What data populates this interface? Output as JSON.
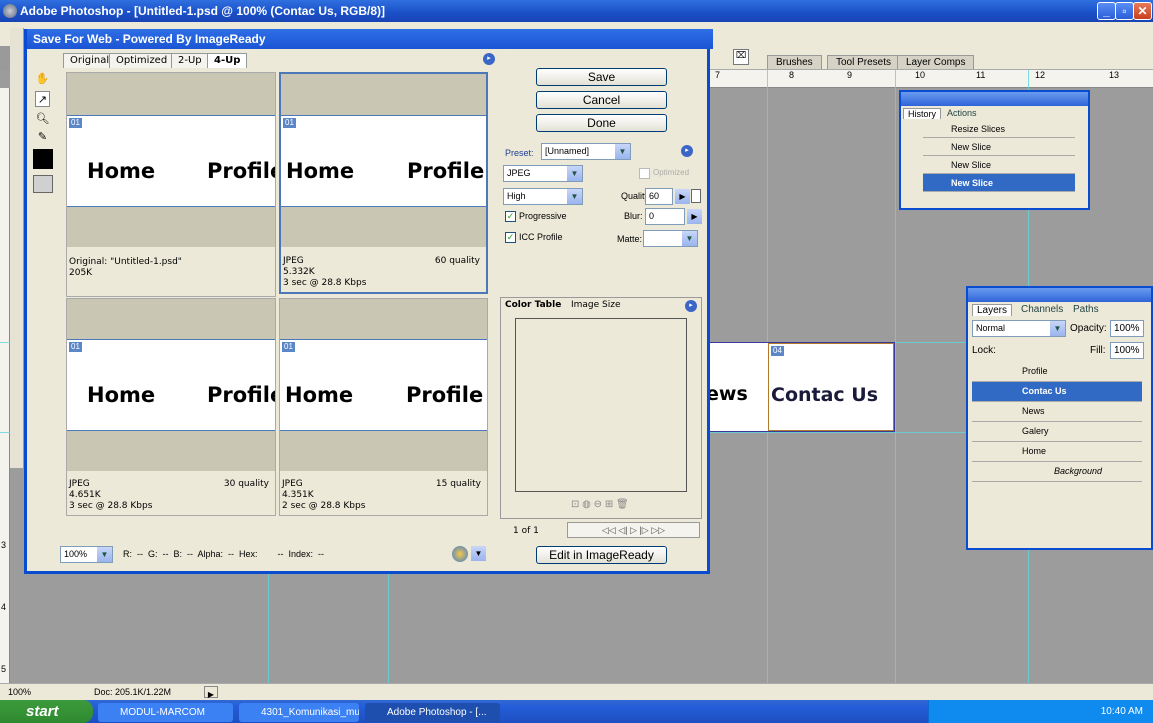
{
  "app": {
    "title": "Adobe Photoshop - [Untitled-1.psd @ 100% (Contac Us, RGB/8)]"
  },
  "palette_well": {
    "tabs": [
      "Brushes",
      "Tool Presets",
      "Layer Comps"
    ]
  },
  "rulers": {
    "top": [
      "7",
      "8",
      "9",
      "10",
      "11",
      "12",
      "13"
    ],
    "left": [
      "3",
      "4",
      "5"
    ]
  },
  "canvas": {
    "visible_text_1": "ews",
    "visible_text_2": "Contac Us",
    "slice_tag": "04"
  },
  "dialog": {
    "title": "Save For Web - Powered By ImageReady",
    "tabs": [
      "Original",
      "Optimized",
      "2-Up",
      "4-Up"
    ],
    "active_tab": "4-Up",
    "panes": [
      {
        "slice": "01",
        "home": "Home",
        "profile": "Profile",
        "info_left": [
          "Original: \"Untitled-1.psd\"",
          "205K"
        ],
        "info_right": ""
      },
      {
        "slice": "01",
        "home": "Home",
        "profile": "Profile",
        "info_left": [
          "JPEG",
          "5.332K",
          "3 sec @ 28.8 Kbps"
        ],
        "info_right": "60 quality"
      },
      {
        "slice": "01",
        "home": "Home",
        "profile": "Profile",
        "info_left": [
          "JPEG",
          "4.651K",
          "3 sec @ 28.8 Kbps"
        ],
        "info_right": "30 quality"
      },
      {
        "slice": "01",
        "home": "Home",
        "profile": "Profile",
        "info_left": [
          "JPEG",
          "4.351K",
          "2 sec @ 28.8 Kbps"
        ],
        "info_right": "15 quality"
      }
    ],
    "buttons": {
      "save": "Save",
      "cancel": "Cancel",
      "done": "Done",
      "edit": "Edit in ImageReady"
    },
    "settings": {
      "preset_label": "Preset:",
      "preset_value": "[Unnamed]",
      "format": "JPEG",
      "optimized_label": "Optimized",
      "quality_level": "High",
      "quality_label": "Quality:",
      "quality_value": "60",
      "progressive_label": "Progressive",
      "blur_label": "Blur:",
      "blur_value": "0",
      "icc_label": "ICC Profile",
      "matte_label": "Matte:"
    },
    "color_tabs": [
      "Color Table",
      "Image Size"
    ],
    "pager": "1 of 1",
    "zoom": "100%",
    "status_fields": "R:  --  G:  --  B:  --  Alpha:  --  Hex:        --  Index:  --"
  },
  "history": {
    "tabs": [
      "History",
      "Actions"
    ],
    "items": [
      "Resize Slices",
      "New Slice",
      "New Slice",
      "New Slice"
    ],
    "selected_index": 3
  },
  "layers": {
    "tabs": [
      "Layers",
      "Channels",
      "Paths"
    ],
    "blend": "Normal",
    "opacity_label": "Opacity:",
    "opacity": "100%",
    "lock_label": "Lock:",
    "fill_label": "Fill:",
    "fill": "100%",
    "items": [
      "Profile",
      "Contac Us",
      "News",
      "Galery",
      "Home",
      "Background"
    ],
    "selected_index": 1
  },
  "statusbar": {
    "zoom": "100%",
    "doc": "Doc: 205.1K/1.22M"
  },
  "taskbar": {
    "start": "start",
    "tasks": [
      "MODUL-MARCOM",
      "4301_Komunikasi_mul...",
      "Adobe Photoshop - [..."
    ],
    "time": "10:40 AM"
  }
}
